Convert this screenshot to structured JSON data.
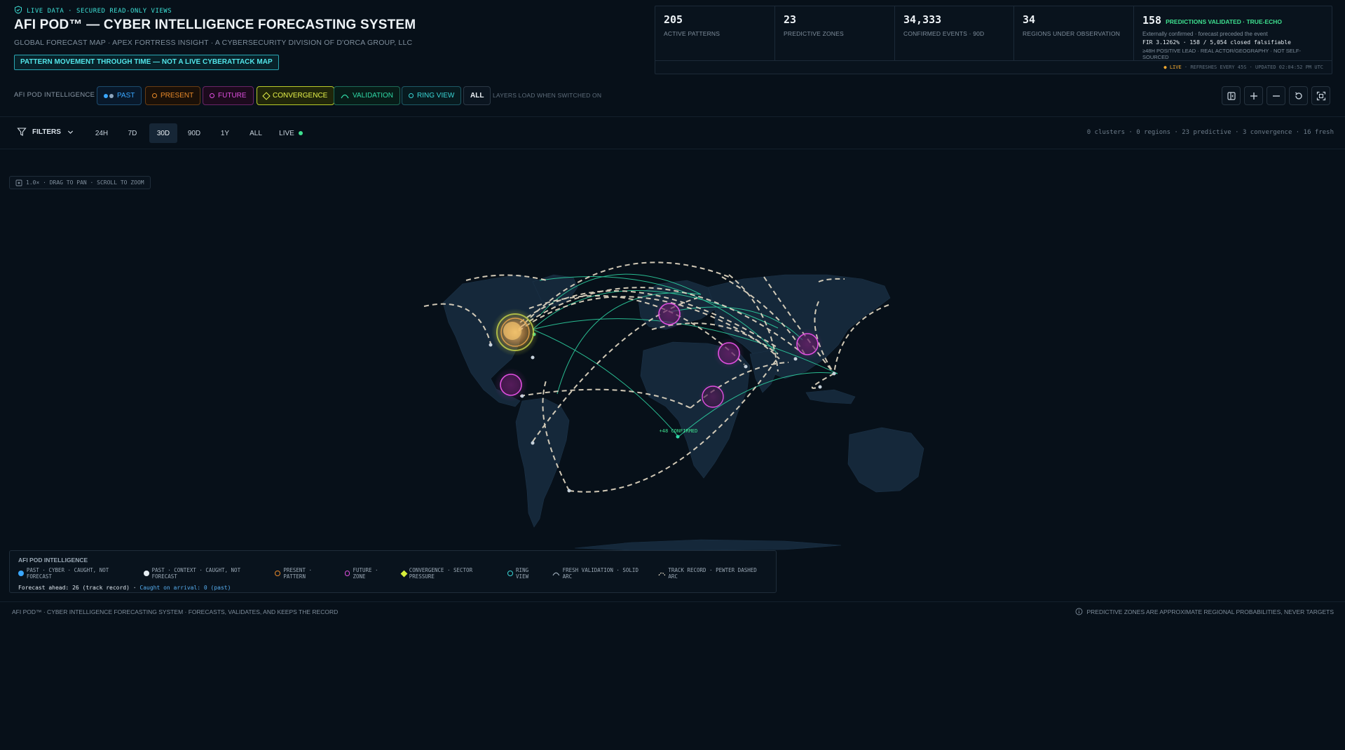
{
  "header": {
    "live_label": "LIVE DATA · SECURED READ-ONLY VIEWS",
    "title": "AFI POD™ — CYBER INTELLIGENCE FORECASTING SYSTEM",
    "subtitle": "GLOBAL FORECAST MAP · APEX FORTRESS INSIGHT · A CYBERSECURITY DIVISION OF D'ORCA GROUP, LLC",
    "disclaimer": "PATTERN MOVEMENT THROUGH TIME — NOT A LIVE CYBERATTACK MAP"
  },
  "stats": [
    {
      "value": "205",
      "label": "ACTIVE PATTERNS"
    },
    {
      "value": "23",
      "label": "PREDICTIVE ZONES"
    },
    {
      "value": "34,333",
      "label": "CONFIRMED EVENTS · 90D"
    },
    {
      "value": "34",
      "label": "REGIONS UNDER OBSERVATION"
    }
  ],
  "validated": {
    "value": "158",
    "badge": "PREDICTIONS VALIDATED · TRUE-ECHO",
    "line1": "Externally confirmed · forecast preceded the event",
    "line2": "FIR 3.1262% · 158 / 5,054 closed falsifiable",
    "line3": "≥48H POSITIVE LEAD · REAL ACTOR/GEOGRAPHY · NOT SELF-SOURCED"
  },
  "stats_footer": {
    "live": "● LIVE",
    "rest": " · REFRESHES EVERY 45S · UPDATED 02:04:52 PM UTC"
  },
  "layers": {
    "lead": "AFI POD INTELLIGENCE",
    "past": "PAST",
    "present": "PRESENT",
    "future": "FUTURE",
    "convergence": "CONVERGENCE",
    "validation": "VALIDATION",
    "ring_view": "RING VIEW",
    "all": "ALL",
    "hint": "LAYERS LOAD WHEN SWITCHED ON"
  },
  "filters": {
    "label": "FILTERS",
    "ranges": [
      "24H",
      "7D",
      "30D",
      "90D",
      "1Y",
      "ALL",
      "LIVE"
    ],
    "active": "30D",
    "summary": "0 clusters · 0 regions · 23 predictive · 3 convergence · 16 fresh"
  },
  "map": {
    "zoom_hint": "1.0× · DRAG TO PAN · SCROLL TO ZOOM",
    "confirmed_tag": "+48 CONFIRMED"
  },
  "legend": {
    "title": "AFI POD INTELLIGENCE",
    "items": [
      "PAST · CYBER · CAUGHT, NOT FORECAST",
      "PAST · CONTEXT · CAUGHT, NOT FORECAST",
      "PRESENT · PATTERN",
      "FUTURE · ZONE",
      "CONVERGENCE · SECTOR PRESSURE",
      "RING VIEW",
      "FRESH VALIDATION · SOLID ARC",
      "TRACK RECORD · PEWTER DASHED ARC"
    ],
    "forecast_ahead": "Forecast ahead: 26 (track record) · ",
    "caught": "Caught on arrival: 0 (past)"
  },
  "footer": {
    "left": "AFI POD™ · CYBER INTELLIGENCE FORECASTING SYSTEM · FORECASTS, VALIDATES, AND KEEPS THE RECORD",
    "right": "PREDICTIVE ZONES ARE APPROXIMATE REGIONAL PROBABILITIES, NEVER TARGETS"
  },
  "colors": {
    "past": "#3aa7ff",
    "present": "#e98a2a",
    "future": "#e04fe0",
    "convergence": "#d7ee3a",
    "validation": "#2fd9a6",
    "ring": "#3ad6d6",
    "track": "#e7dcc6"
  }
}
